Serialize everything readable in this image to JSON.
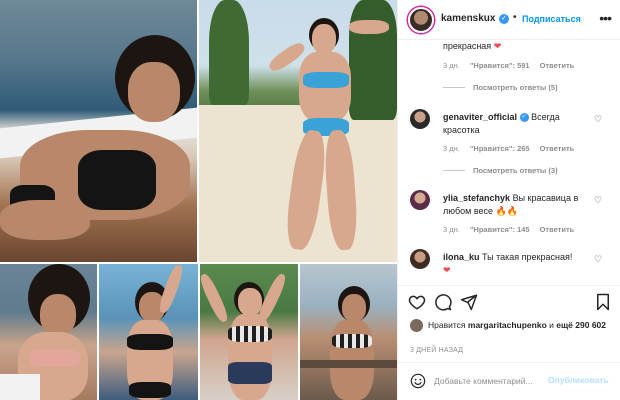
{
  "header": {
    "username": "kamenskux",
    "separator": "•",
    "follow_label": "Подписаться",
    "more_icon": "more-horizontal-icon"
  },
  "comments": {
    "partial": {
      "text_tail": "прекрасная",
      "age": "3 дн.",
      "likes": "\"Нравится\": 591",
      "reply": "Ответить",
      "view_replies": "Посмотреть ответы (5)"
    },
    "items": [
      {
        "username": "genaviter_official",
        "text": "Всегда красотка",
        "age": "3 дн.",
        "likes": "\"Нравится\": 265",
        "reply": "Ответить",
        "view_replies": "Посмотреть ответы (3)"
      },
      {
        "username": "ylia_stefanchyk",
        "text": "Вы красавица в любом весе",
        "emoji": "🔥🔥",
        "age": "3 дн.",
        "likes": "\"Нравится\": 145",
        "reply": "Ответить"
      },
      {
        "username": "ilona_ku",
        "text": "Ты такая прекрасная!",
        "emoji": "❤"
      }
    ]
  },
  "likes": {
    "prefix": "Нравится",
    "user": "margaritachupenko",
    "conj": "и",
    "rest": "ещё 290 602"
  },
  "timestamp": "3 ДНЕЙ НАЗАД",
  "comment_box": {
    "placeholder": "Добавьте комментарий...",
    "post_label": "Опубликовать"
  },
  "colors": {
    "accent_blue": "#0095f6",
    "verified_blue": "#3897f0",
    "heart_red": "#ed4956",
    "muted_text": "#8e8e8e"
  }
}
